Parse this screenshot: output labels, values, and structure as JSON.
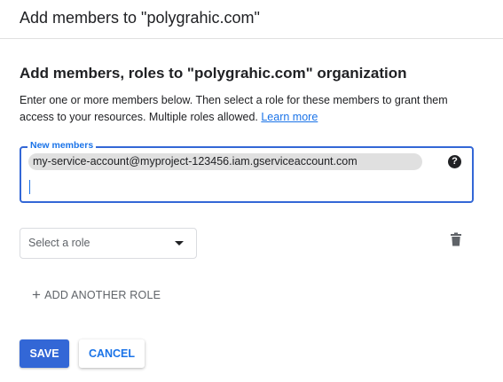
{
  "dialog": {
    "title": "Add members to \"polygrahic.com\""
  },
  "section": {
    "title": "Add members, roles to \"polygrahic.com\" organization",
    "description": "Enter one or more members below. Then select a role for these members to grant them access to your resources. Multiple roles allowed.",
    "learn_more": "Learn more"
  },
  "members": {
    "label": "New members",
    "chips": [
      "my-service-account@myproject-123456.iam.gserviceaccount.com"
    ],
    "help_icon": "?"
  },
  "role": {
    "placeholder": "Select a role"
  },
  "add_role": {
    "plus": "+",
    "label": "ADD ANOTHER ROLE"
  },
  "actions": {
    "save": "SAVE",
    "cancel": "CANCEL"
  },
  "icons": {
    "help": "help-icon",
    "delete": "trash-icon",
    "dropdown": "dropdown-arrow-icon",
    "add": "plus-icon"
  },
  "colors": {
    "primary": "#3367d6",
    "link": "#1a73e8",
    "chip": "#e0e0e0",
    "text": "#202124",
    "muted": "#5f6368"
  }
}
